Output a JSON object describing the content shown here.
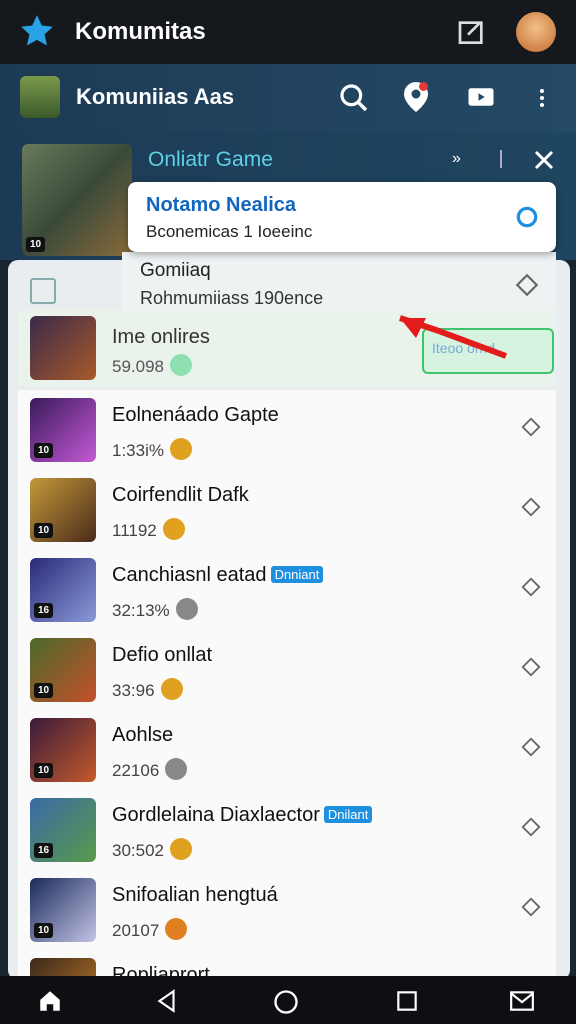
{
  "topbar": {
    "title": "Komumitas"
  },
  "appbar": {
    "name": "Komuniias Aas"
  },
  "header": {
    "label": "Onliatr Game"
  },
  "popup": {
    "title": "Notamo Nealica",
    "subtitle": "Bconemicas 1 Ioeeinc"
  },
  "dropdown": {
    "title": "Gomiiaq",
    "subtitle": "Rohmumiiass 190ence"
  },
  "featured": {
    "title": "Ime onlires",
    "count": "59.098",
    "age": "10",
    "button": "Iteoo ornd"
  },
  "list": [
    {
      "title": "Eolnenáado Gapte",
      "count": "1:33i%",
      "age": "10"
    },
    {
      "title": "Coirfendlit Dafk",
      "count": "11192",
      "age": "10"
    },
    {
      "title": "Canchiasnl eatad",
      "tag": "Dnniant",
      "count": "32:13%",
      "age": "16"
    },
    {
      "title": "Defio onllat",
      "count": "33:96",
      "age": "10"
    },
    {
      "title": "Aohlse",
      "count": "22106",
      "age": "10"
    },
    {
      "title": "Gordlelaina Diaxlaector",
      "tag": "Dnilant",
      "count": "30:502",
      "age": "16"
    },
    {
      "title": "Snifoalian hengtuá",
      "count": "20107",
      "age": "10"
    },
    {
      "title": "Ropliaprort"
    }
  ],
  "colors": {
    "accent": "#2aa3e6",
    "topbar": "#15181d",
    "appbar": "#1f4660",
    "ok": "#3ec46d"
  },
  "icons": {
    "star": "star-icon",
    "edit": "edit-icon",
    "search": "search-icon",
    "bell": "location-bell-icon",
    "video": "video-icon",
    "more": "more-vertical-icon",
    "close": "close-icon",
    "arrow": "diamond-arrow-icon"
  }
}
